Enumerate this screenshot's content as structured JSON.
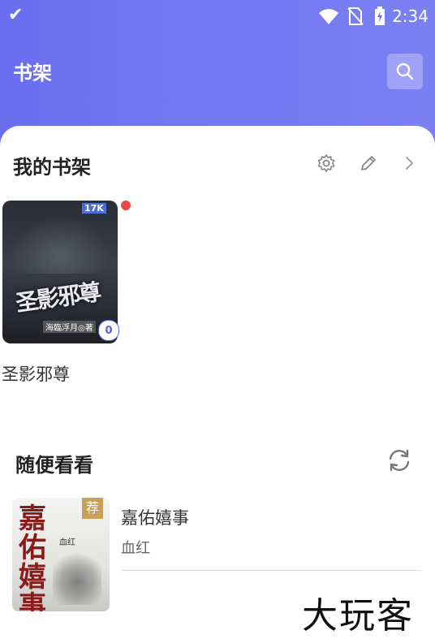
{
  "status_bar": {
    "time": "2:34",
    "left_icon": "checkmark-icon",
    "icons": [
      "wifi-icon",
      "no-sim-icon",
      "battery-icon"
    ]
  },
  "header": {
    "title": "书架",
    "search_icon": "search-icon"
  },
  "my_shelf": {
    "title": "我的书架",
    "actions": [
      "gear-icon",
      "pencil-icon",
      "chevron-right-icon"
    ],
    "books": [
      {
        "name": "圣影邪尊",
        "cover_title": "圣影邪尊",
        "cover_logo": "17K",
        "cover_author": "海臨浮月◎著",
        "progress_badge": "0",
        "has_update_dot": true
      }
    ]
  },
  "recommend": {
    "title": "随便看看",
    "refresh_icon": "refresh-icon",
    "items": [
      {
        "title": "嘉佑嬉事",
        "author": "血红",
        "cover_title": "嘉佑嬉事",
        "cover_tag": "荐",
        "cover_small": "血红"
      }
    ]
  },
  "watermark": "大玩客",
  "colors": {
    "header_gradient_start": "#6a6ff0",
    "header_gradient_end": "#7c80f3",
    "accent": "#5a5fe8",
    "update_dot": "#e94747"
  }
}
